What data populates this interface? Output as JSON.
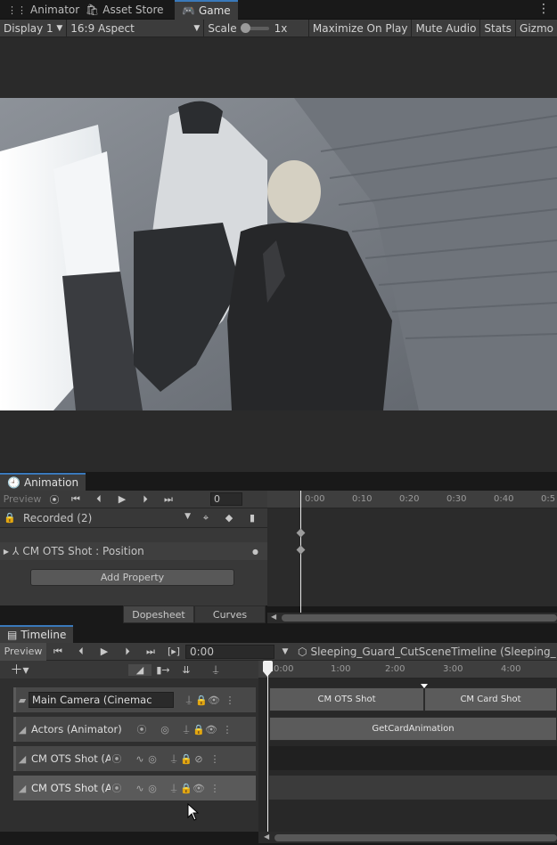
{
  "tabs": [
    {
      "label": "Animator",
      "icon": "animator-icon"
    },
    {
      "label": "Asset Store",
      "icon": "bag-icon"
    },
    {
      "label": "Game",
      "icon": "gamepad-icon"
    }
  ],
  "game_toolbar": {
    "display": "Display 1",
    "aspect": "16:9 Aspect",
    "scale_label": "Scale",
    "scale_value": "1x",
    "maximize": "Maximize On Play",
    "mute": "Mute Audio",
    "stats": "Stats",
    "gizmos": "Gizmo"
  },
  "animation": {
    "title": "Animation",
    "preview": "Preview",
    "frame": "0",
    "clip": "Recorded (2)",
    "ruler": [
      "0:00",
      "0:10",
      "0:20",
      "0:30",
      "0:40",
      "0:5"
    ],
    "property": "CM OTS Shot : Position",
    "add_property": "Add Property",
    "dopesheet": "Dopesheet",
    "curves": "Curves"
  },
  "timeline": {
    "title": "Timeline",
    "preview": "Preview",
    "time": "0:00",
    "asset": "Sleeping_Guard_CutSceneTimeline (Sleeping_",
    "ruler": [
      "0:00",
      "1:00",
      "2:00",
      "3:00",
      "4:00"
    ],
    "tracks": [
      {
        "name": "Main Camera (Cinemac",
        "icon": "cinemachine-track-icon"
      },
      {
        "name": "Actors (Animator)",
        "icon": "animation-track-icon"
      },
      {
        "name": "CM OTS Shot (A",
        "icon": "animation-track-icon"
      },
      {
        "name": "CM OTS Shot (A",
        "icon": "animation-track-icon"
      }
    ],
    "clips": {
      "camera_1": "CM OTS Shot",
      "camera_2": "CM Card Shot",
      "actors": "GetCardAnimation"
    }
  },
  "colors": {
    "accent": "#3a79bb",
    "background": "#191919",
    "panel": "#383838"
  }
}
